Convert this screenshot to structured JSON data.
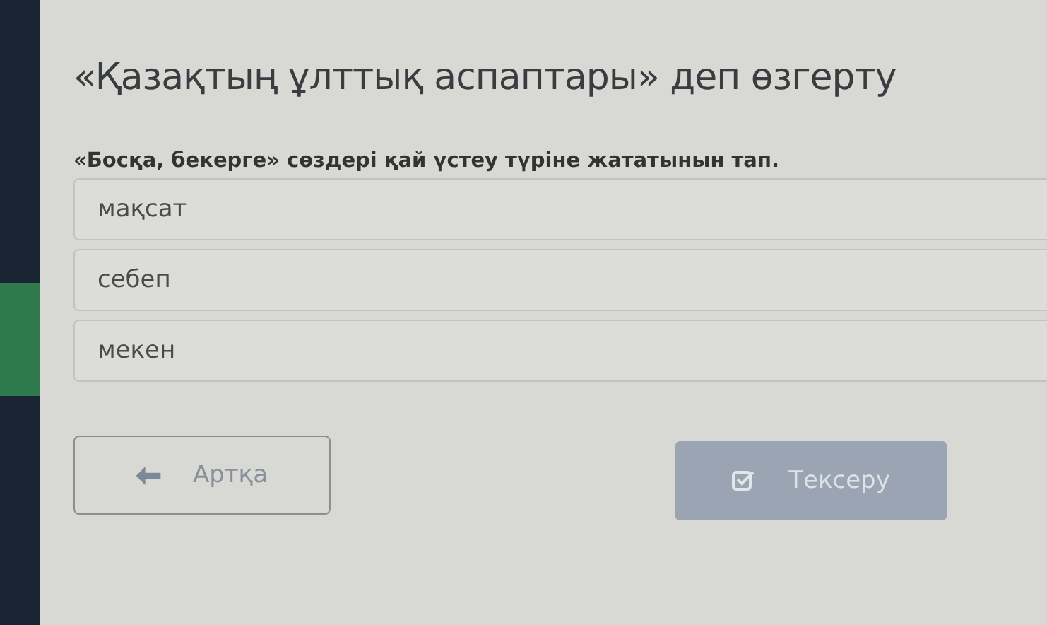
{
  "title": "«Қазақтың ұлттық аспаптары» деп өзгерту",
  "question": "«Босқа, бекерге» сөздері қай үстеу түріне жататынын тап.",
  "options": [
    {
      "label": "мақсат",
      "selected": false
    },
    {
      "label": "себеп",
      "selected": false
    },
    {
      "label": "мекен",
      "selected": false
    }
  ],
  "back_button": {
    "label": "Артқа"
  },
  "check_button": {
    "label": "Тексеру",
    "disabled": true
  }
}
